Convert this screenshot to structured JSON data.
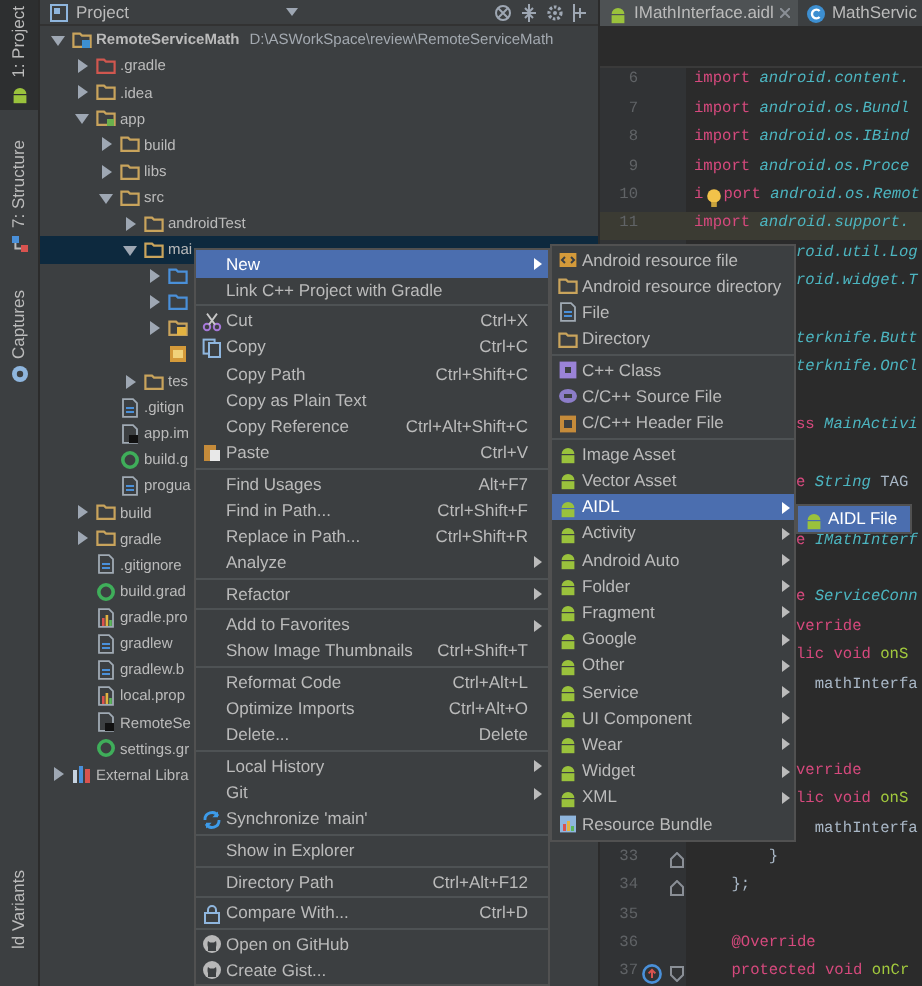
{
  "tool_windows": [
    {
      "label": "1: Project",
      "kind": "android",
      "selected": true
    },
    {
      "label": "7: Structure",
      "kind": "structure",
      "selected": false
    },
    {
      "label": "Captures",
      "kind": "capture",
      "selected": false
    },
    {
      "label": "ld Variants",
      "kind": "plain",
      "selected": false
    }
  ],
  "project_panel": {
    "title": "Project"
  },
  "tree": [
    {
      "label": "RemoteServiceMath",
      "path": "D:\\ASWorkSpace\\review\\RemoteServiceMath",
      "kind": "project-folder",
      "expanded": true,
      "selected": false,
      "children": [
        {
          "label": ".gradle",
          "kind": "excluded-folder",
          "expanded": false,
          "selected": false
        },
        {
          "label": ".idea",
          "kind": "folder",
          "expanded": false,
          "selected": false
        },
        {
          "label": "app",
          "kind": "module-folder",
          "expanded": true,
          "selected": false,
          "children": [
            {
              "label": "build",
              "kind": "folder",
              "expanded": false,
              "selected": false
            },
            {
              "label": "libs",
              "kind": "folder",
              "expanded": false,
              "selected": false
            },
            {
              "label": "src",
              "kind": "folder",
              "expanded": true,
              "selected": false,
              "children": [
                {
                  "label": "androidTest",
                  "kind": "folder",
                  "expanded": false,
                  "selected": false
                },
                {
                  "label": "mai",
                  "kind": "folder",
                  "expanded": true,
                  "selected": true,
                  "children": [
                    {
                      "kind": "source-folder",
                      "expanded": false,
                      "selected": false
                    },
                    {
                      "kind": "source-folder",
                      "expanded": false,
                      "selected": false
                    },
                    {
                      "kind": "res-folder",
                      "expanded": false,
                      "selected": false
                    },
                    {
                      "kind": "manifest",
                      "selected": false
                    }
                  ]
                },
                {
                  "label": "tes",
                  "kind": "folder",
                  "expanded": false,
                  "selected": false
                }
              ]
            },
            {
              "label": ".gitign",
              "kind": "file",
              "selected": false
            },
            {
              "label": "app.im",
              "kind": "locked-file",
              "selected": false
            },
            {
              "label": "build.g",
              "kind": "gradle",
              "selected": false
            },
            {
              "label": "progua",
              "kind": "file",
              "selected": false
            }
          ]
        },
        {
          "label": "build",
          "kind": "folder",
          "expanded": false,
          "selected": false
        },
        {
          "label": "gradle",
          "kind": "folder",
          "expanded": false,
          "selected": false
        },
        {
          "label": ".gitignore",
          "kind": "file",
          "selected": false
        },
        {
          "label": "build.grad",
          "kind": "gradle",
          "selected": false
        },
        {
          "label": "gradle.pro",
          "kind": "properties",
          "selected": false
        },
        {
          "label": "gradlew",
          "kind": "file",
          "selected": false
        },
        {
          "label": "gradlew.b",
          "kind": "file",
          "selected": false
        },
        {
          "label": "local.prop",
          "kind": "properties",
          "selected": false
        },
        {
          "label": "RemoteSe",
          "kind": "locked-file",
          "selected": false
        },
        {
          "label": "settings.gr",
          "kind": "gradle",
          "selected": false
        }
      ]
    },
    {
      "label": "External Libra",
      "kind": "library",
      "expanded": false,
      "selected": false
    }
  ],
  "editor_tabs": [
    {
      "label": "IMathInterface.aidl",
      "kind": "android",
      "selected": true,
      "closable": true
    },
    {
      "label": "MathServic",
      "kind": "class",
      "selected": false,
      "closable": false
    }
  ],
  "code_lines": [
    {
      "kind": "full",
      "number": "6",
      "current": false,
      "tokens": [
        {
          "text": "import",
          "kind": "keyword"
        },
        {
          "text": " android.content.",
          "kind": "package"
        }
      ]
    },
    {
      "kind": "full",
      "number": "7",
      "current": false,
      "tokens": [
        {
          "text": "import",
          "kind": "keyword"
        },
        {
          "text": " android.os.Bundl",
          "kind": "package"
        }
      ]
    },
    {
      "kind": "full",
      "number": "8",
      "current": false,
      "tokens": [
        {
          "text": "import",
          "kind": "keyword"
        },
        {
          "text": " android.os.IBind",
          "kind": "package"
        }
      ]
    },
    {
      "kind": "full",
      "number": "9",
      "current": false,
      "tokens": [
        {
          "text": "import",
          "kind": "keyword"
        },
        {
          "text": " android.os.Proce",
          "kind": "package"
        }
      ]
    },
    {
      "kind": "bulb",
      "number": "10",
      "current": false,
      "tokens": [
        {
          "text": "i",
          "kind": "keyword"
        },
        {
          "text": "port",
          "kind": "keyword"
        },
        {
          "text": " android.os.Remot",
          "kind": "package"
        }
      ]
    },
    {
      "kind": "full",
      "number": "11",
      "current": true,
      "tokens": [
        {
          "text": "import",
          "kind": "keyword"
        },
        {
          "text": " android.support.",
          "kind": "package"
        }
      ]
    },
    {
      "kind": "partial",
      "tokens": [
        {
          "text": "roid.util.Log",
          "kind": "package"
        }
      ]
    },
    {
      "kind": "partial",
      "tokens": [
        {
          "text": "roid.widget.T",
          "kind": "package"
        }
      ]
    },
    {
      "kind": "blank"
    },
    {
      "kind": "partial",
      "tokens": [
        {
          "text": "terknife.Butt",
          "kind": "package"
        }
      ]
    },
    {
      "kind": "partial",
      "tokens": [
        {
          "text": "terknife.OnCl",
          "kind": "package"
        }
      ]
    },
    {
      "kind": "blank"
    },
    {
      "kind": "partial",
      "tokens": [
        {
          "text": "ss",
          "kind": "keyword"
        },
        {
          "text": " MainActivi",
          "kind": "package"
        }
      ]
    },
    {
      "kind": "blank"
    },
    {
      "kind": "partial",
      "tokens": [
        {
          "text": "e",
          "kind": "keyword"
        },
        {
          "text": " String",
          "kind": "package"
        },
        {
          "text": " TAG",
          "kind": "plain"
        }
      ]
    },
    {
      "kind": "blank"
    },
    {
      "kind": "partial",
      "tokens": [
        {
          "text": "e",
          "kind": "keyword"
        },
        {
          "text": " IMathInterf",
          "kind": "package"
        }
      ]
    },
    {
      "kind": "blank"
    },
    {
      "kind": "partial",
      "tokens": [
        {
          "text": "e",
          "kind": "keyword"
        },
        {
          "text": " ServiceConn",
          "kind": "package"
        }
      ]
    },
    {
      "kind": "partial",
      "tokens": [
        {
          "text": "verride",
          "kind": "keyword"
        }
      ]
    },
    {
      "kind": "partial",
      "tokens": [
        {
          "text": "lic void",
          "kind": "keyword"
        },
        {
          "text": " onS",
          "kind": "method"
        }
      ]
    },
    {
      "kind": "partial",
      "tokens": [
        {
          "text": "  mathInterfa",
          "kind": "plain"
        }
      ]
    },
    {
      "kind": "blank"
    },
    {
      "kind": "blank"
    },
    {
      "kind": "partial",
      "tokens": [
        {
          "text": "verride",
          "kind": "keyword"
        }
      ]
    },
    {
      "kind": "partial",
      "tokens": [
        {
          "text": "lic void",
          "kind": "keyword"
        },
        {
          "text": " onS",
          "kind": "method"
        }
      ]
    },
    {
      "kind": "partial",
      "tokens": [
        {
          "text": "  mathInterfa",
          "kind": "plain"
        }
      ]
    },
    {
      "kind": "fold-end",
      "number": "33",
      "current": false,
      "tokens": [
        {
          "text": "        }",
          "kind": "plain"
        }
      ]
    },
    {
      "kind": "fold-end",
      "number": "34",
      "current": false,
      "tokens": [
        {
          "text": "    };",
          "kind": "plain"
        }
      ]
    },
    {
      "kind": "full",
      "number": "35",
      "current": false
    },
    {
      "kind": "full",
      "number": "36",
      "current": false,
      "tokens": [
        {
          "text": "    @Override",
          "kind": "keyword"
        }
      ]
    },
    {
      "kind": "override-fold",
      "number": "37",
      "current": false,
      "tokens": [
        {
          "text": "    protected void",
          "kind": "keyword"
        },
        {
          "text": " onCr",
          "kind": "method"
        }
      ]
    }
  ],
  "context_menu": [
    {
      "kind": "plain",
      "label": "New",
      "submenu": true,
      "selected": true
    },
    {
      "kind": "plain",
      "label": "Link C++ Project with Gradle",
      "submenu": false,
      "selected": false
    },
    {
      "kind": "separator"
    },
    {
      "kind": "cut",
      "label": "Cut",
      "shortcut": "Ctrl+X",
      "submenu": false,
      "selected": false
    },
    {
      "kind": "copy",
      "label": "Copy",
      "shortcut": "Ctrl+C",
      "submenu": false,
      "selected": false
    },
    {
      "kind": "plain",
      "label": "Copy Path",
      "shortcut": "Ctrl+Shift+C",
      "submenu": false,
      "selected": false
    },
    {
      "kind": "plain",
      "label": "Copy as Plain Text",
      "submenu": false,
      "selected": false
    },
    {
      "kind": "plain",
      "label": "Copy Reference",
      "shortcut": "Ctrl+Alt+Shift+C",
      "submenu": false,
      "selected": false
    },
    {
      "kind": "paste",
      "label": "Paste",
      "shortcut": "Ctrl+V",
      "submenu": false,
      "selected": false
    },
    {
      "kind": "separator"
    },
    {
      "kind": "plain",
      "label": "Find Usages",
      "shortcut": "Alt+F7",
      "submenu": false,
      "selected": false
    },
    {
      "kind": "plain",
      "label": "Find in Path...",
      "shortcut": "Ctrl+Shift+F",
      "submenu": false,
      "selected": false
    },
    {
      "kind": "plain",
      "label": "Replace in Path...",
      "shortcut": "Ctrl+Shift+R",
      "submenu": false,
      "selected": false
    },
    {
      "kind": "plain",
      "label": "Analyze",
      "submenu": true,
      "selected": false
    },
    {
      "kind": "separator"
    },
    {
      "kind": "plain",
      "label": "Refactor",
      "submenu": true,
      "selected": false
    },
    {
      "kind": "separator"
    },
    {
      "kind": "plain",
      "label": "Add to Favorites",
      "submenu": true,
      "selected": false
    },
    {
      "kind": "plain",
      "label": "Show Image Thumbnails",
      "shortcut": "Ctrl+Shift+T",
      "submenu": false,
      "selected": false
    },
    {
      "kind": "separator"
    },
    {
      "kind": "plain",
      "label": "Reformat Code",
      "shortcut": "Ctrl+Alt+L",
      "submenu": false,
      "selected": false
    },
    {
      "kind": "plain",
      "label": "Optimize Imports",
      "shortcut": "Ctrl+Alt+O",
      "submenu": false,
      "selected": false
    },
    {
      "kind": "plain",
      "label": "Delete...",
      "shortcut": "Delete",
      "submenu": false,
      "selected": false
    },
    {
      "kind": "separator"
    },
    {
      "kind": "plain",
      "label": "Local History",
      "submenu": true,
      "selected": false
    },
    {
      "kind": "plain",
      "label": "Git",
      "submenu": true,
      "selected": false
    },
    {
      "kind": "sync",
      "label": "Synchronize 'main'",
      "submenu": false,
      "selected": false
    },
    {
      "kind": "separator"
    },
    {
      "kind": "plain",
      "label": "Show in Explorer",
      "submenu": false,
      "selected": false
    },
    {
      "kind": "separator"
    },
    {
      "kind": "plain",
      "label": "Directory Path",
      "shortcut": "Ctrl+Alt+F12",
      "submenu": false,
      "selected": false
    },
    {
      "kind": "separator"
    },
    {
      "kind": "compare",
      "label": "Compare With...",
      "shortcut": "Ctrl+D",
      "submenu": false,
      "selected": false
    },
    {
      "kind": "separator"
    },
    {
      "kind": "github",
      "label": "Open on GitHub",
      "submenu": false,
      "selected": false
    },
    {
      "kind": "github",
      "label": "Create Gist...",
      "submenu": false,
      "selected": false
    }
  ],
  "new_submenu": [
    {
      "kind": "resource-file",
      "label": "Android resource file",
      "submenu": false,
      "selected": false
    },
    {
      "kind": "folder",
      "label": "Android resource directory",
      "submenu": false,
      "selected": false
    },
    {
      "kind": "file",
      "label": "File",
      "submenu": false,
      "selected": false
    },
    {
      "kind": "folder",
      "label": "Directory",
      "submenu": false,
      "selected": false
    },
    {
      "kind": "separator"
    },
    {
      "kind": "cpp-class",
      "label": "C++ Class",
      "submenu": false,
      "selected": false
    },
    {
      "kind": "cpp-source",
      "label": "C/C++ Source File",
      "submenu": false,
      "selected": false
    },
    {
      "kind": "cpp-header",
      "label": "C/C++ Header File",
      "submenu": false,
      "selected": false
    },
    {
      "kind": "separator"
    },
    {
      "kind": "android",
      "label": "Image Asset",
      "submenu": false,
      "selected": false
    },
    {
      "kind": "android",
      "label": "Vector Asset",
      "submenu": false,
      "selected": false
    },
    {
      "kind": "android",
      "label": "AIDL",
      "submenu": true,
      "selected": true
    },
    {
      "kind": "android",
      "label": "Activity",
      "submenu": true,
      "selected": false
    },
    {
      "kind": "android",
      "label": "Android Auto",
      "submenu": true,
      "selected": false
    },
    {
      "kind": "android",
      "label": "Folder",
      "submenu": true,
      "selected": false
    },
    {
      "kind": "android",
      "label": "Fragment",
      "submenu": true,
      "selected": false
    },
    {
      "kind": "android",
      "label": "Google",
      "submenu": true,
      "selected": false
    },
    {
      "kind": "android",
      "label": "Other",
      "submenu": true,
      "selected": false
    },
    {
      "kind": "android",
      "label": "Service",
      "submenu": true,
      "selected": false
    },
    {
      "kind": "android",
      "label": "UI Component",
      "submenu": true,
      "selected": false
    },
    {
      "kind": "android",
      "label": "Wear",
      "submenu": true,
      "selected": false
    },
    {
      "kind": "android",
      "label": "Widget",
      "submenu": true,
      "selected": false
    },
    {
      "kind": "android",
      "label": "XML",
      "submenu": true,
      "selected": false
    },
    {
      "kind": "resource-bundle",
      "label": "Resource Bundle",
      "submenu": false,
      "selected": false
    }
  ],
  "aidl_submenu": [
    {
      "kind": "android",
      "label": "AIDL File",
      "submenu": false,
      "selected": true
    }
  ]
}
